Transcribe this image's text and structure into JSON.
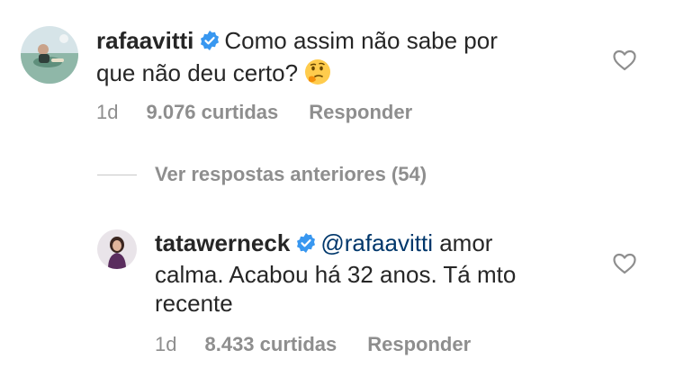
{
  "comment1": {
    "username": "rafaavitti",
    "text_line1": "Como assim não sabe por",
    "text_line2": "que não deu certo?",
    "emoji": "thinking-face-emoji",
    "time": "1d",
    "likes": "9.076 curtidas",
    "reply": "Responder"
  },
  "view_replies": {
    "label": "Ver respostas anteriores (54)"
  },
  "comment2": {
    "username": "tatawerneck",
    "mention": "@rafaavitti",
    "text_line1_rest": "amor",
    "text_line2": "calma. Acabou há 32 anos. Tá mto",
    "text_line3": "recente",
    "time": "1d",
    "likes": "8.433 curtidas",
    "reply": "Responder"
  },
  "colors": {
    "verified": "#3897f0",
    "mention": "#00376b",
    "meta": "#8e8e8e",
    "text": "#262626"
  }
}
